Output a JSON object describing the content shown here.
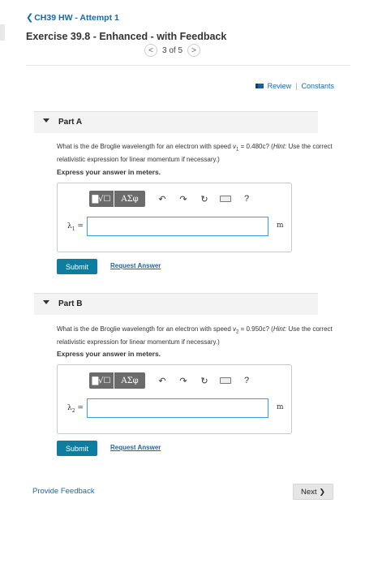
{
  "header": {
    "back_chevron": "❮",
    "back_label": "CH39 HW - Attempt 1",
    "title": "Exercise 39.8 - Enhanced - with Feedback",
    "pager": {
      "prev": "<",
      "text": "3 of 5",
      "next": ">"
    }
  },
  "toplinks": {
    "review": "Review",
    "sep": "|",
    "constants": "Constants"
  },
  "toolbar": {
    "template_glyph": "▇√☐",
    "greek_glyph": "ΑΣφ",
    "undo": "↶",
    "redo": "↷",
    "reset": "↻",
    "help": "?"
  },
  "parts": [
    {
      "label": "Part A",
      "q_prefix": "What is the de Broglie wavelength for an electron with speed ",
      "q_var": "v",
      "q_sub": "1",
      "q_value": " = 0.480c? (",
      "q_hint": "Hint:",
      "q_rest": " Use the correct relativistic expression for linear momentum if necessary.)",
      "express": "Express your answer in meters.",
      "var_symbol": "λ",
      "var_sub": "1",
      "eq": " =",
      "input_value": "",
      "unit": "m",
      "submit": "Submit",
      "request": "Request Answer"
    },
    {
      "label": "Part B",
      "q_prefix": "What is the de Broglie wavelength for an electron with speed ",
      "q_var": "v",
      "q_sub": "2",
      "q_value": " = 0.950c? (",
      "q_hint": "Hint:",
      "q_rest": " Use the correct relativistic expression for linear momentum if necessary.)",
      "express": "Express your answer in meters.",
      "var_symbol": "λ",
      "var_sub": "2",
      "eq": " =",
      "input_value": "",
      "unit": "m",
      "submit": "Submit",
      "request": "Request Answer"
    }
  ],
  "footer": {
    "feedback": "Provide Feedback",
    "next": "Next",
    "next_chevron": "❯"
  },
  "colors": {
    "link": "#1769a8",
    "submit_bg": "#0f7d9f",
    "input_border": "#3b9ed8"
  }
}
